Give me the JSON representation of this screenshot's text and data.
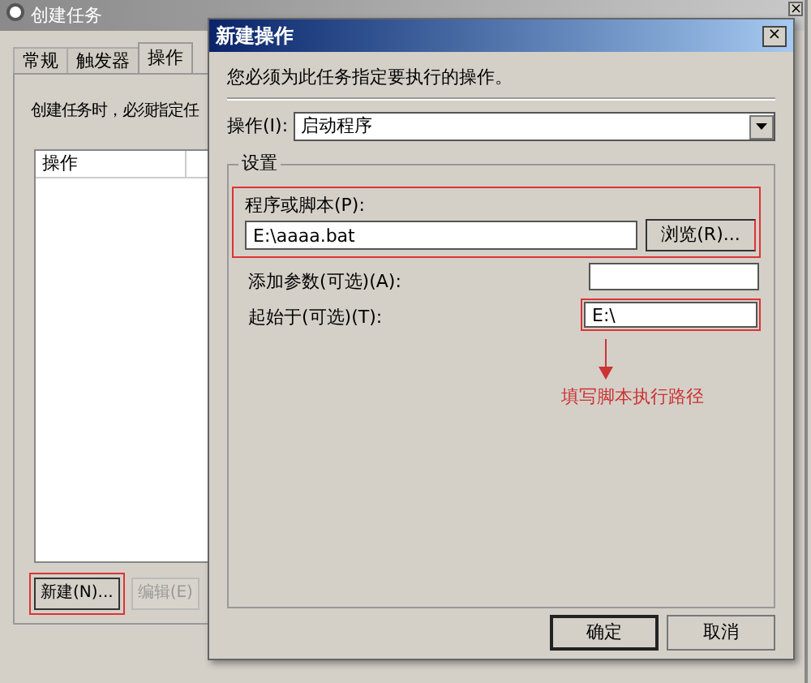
{
  "main_window": {
    "title": "创建任务",
    "close": "×",
    "tabs": [
      {
        "label": "常规",
        "selected": false
      },
      {
        "label": "触发器",
        "selected": false
      },
      {
        "label": "操作",
        "selected": true
      }
    ],
    "description": "创建任务时，必须指定任",
    "list": {
      "columns": [
        "操作"
      ]
    },
    "buttons": [
      {
        "label": "新建(N)...",
        "disabled": false,
        "highlighted": true
      },
      {
        "label": "编辑(E)",
        "disabled": true,
        "highlighted": false
      }
    ]
  },
  "dialog": {
    "title": "新建操作",
    "close": "×",
    "instruction": "您必须为此任务指定要执行的操作。",
    "action": {
      "label": "操作(I):",
      "value": "启动程序"
    },
    "settings": {
      "title": "设置",
      "program": {
        "label": "程序或脚本(P):",
        "value": "E:\\aaaa.bat",
        "browse": "浏览(R)..."
      },
      "arguments": {
        "label": "添加参数(可选)(A):"
      },
      "start_in": {
        "label": "起始于(可选)(T):",
        "value": "E:\\"
      },
      "annotation": "填写脚本执行路径"
    },
    "buttons": [
      "确定",
      "取消"
    ]
  }
}
